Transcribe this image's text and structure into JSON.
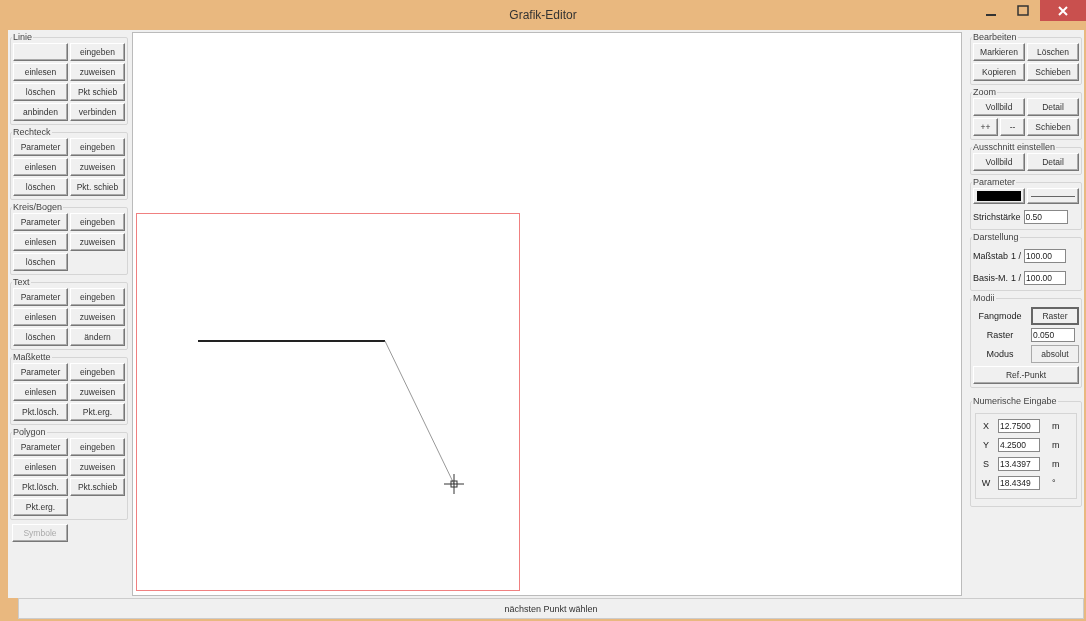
{
  "window": {
    "title": "Grafik-Editor"
  },
  "left_groups": [
    {
      "title": "Linie",
      "buttons": [
        {
          "kind": "blank"
        },
        {
          "label": "eingeben"
        },
        {
          "label": "einlesen"
        },
        {
          "label": "zuweisen"
        },
        {
          "label": "löschen"
        },
        {
          "label": "Pkt schieb"
        },
        {
          "label": "anbinden"
        },
        {
          "label": "verbinden"
        }
      ]
    },
    {
      "title": "Rechteck",
      "buttons": [
        {
          "label": "Parameter"
        },
        {
          "label": "eingeben"
        },
        {
          "label": "einlesen"
        },
        {
          "label": "zuweisen"
        },
        {
          "label": "löschen"
        },
        {
          "label": "Pkt. schieb"
        }
      ]
    },
    {
      "title": "Kreis/Bogen",
      "buttons": [
        {
          "label": "Parameter"
        },
        {
          "label": "eingeben"
        },
        {
          "label": "einlesen"
        },
        {
          "label": "zuweisen"
        },
        {
          "label": "löschen"
        }
      ]
    },
    {
      "title": "Text",
      "buttons": [
        {
          "label": "Parameter"
        },
        {
          "label": "eingeben"
        },
        {
          "label": "einlesen"
        },
        {
          "label": "zuweisen"
        },
        {
          "label": "löschen"
        },
        {
          "label": "ändern"
        }
      ]
    },
    {
      "title": "Maßkette",
      "buttons": [
        {
          "label": "Parameter"
        },
        {
          "label": "eingeben"
        },
        {
          "label": "einlesen"
        },
        {
          "label": "zuweisen"
        },
        {
          "label": "Pkt.lösch."
        },
        {
          "label": "Pkt.erg."
        }
      ]
    },
    {
      "title": "Polygon",
      "buttons": [
        {
          "label": "Parameter"
        },
        {
          "label": "eingeben"
        },
        {
          "label": "einlesen"
        },
        {
          "label": "zuweisen"
        },
        {
          "label": "Pkt.lösch."
        },
        {
          "label": "Pkt.schieb"
        },
        {
          "label": "Pkt.erg."
        }
      ]
    }
  ],
  "symbole_button": {
    "label": "Symbole",
    "disabled": true
  },
  "bearbeiten": {
    "title": "Bearbeiten",
    "buttons": [
      "Markieren",
      "Löschen",
      "Kopieren",
      "Schieben"
    ]
  },
  "zoom": {
    "title": "Zoom",
    "buttons": [
      "Vollbild",
      "Detail"
    ],
    "small_buttons": [
      "++",
      "--"
    ],
    "pan_button": "Schieben"
  },
  "ausschnitt": {
    "title": "Ausschnitt einstellen",
    "buttons": [
      "Vollbild",
      "Detail"
    ]
  },
  "parameter": {
    "title": "Parameter",
    "color": "#000000",
    "stroke_label": "Strichstärke",
    "stroke_value": "0.50"
  },
  "darstellung": {
    "title": "Darstellung",
    "rows": [
      {
        "label": "Maßstab",
        "prefix": "1 /",
        "value": "100.00"
      },
      {
        "label": "Basis-M.",
        "prefix": "1 /",
        "value": "100.00"
      }
    ]
  },
  "modii": {
    "title": "Modii",
    "fangmode_label": "Fangmode",
    "fangmode_button": "Raster",
    "raster_label": "Raster",
    "raster_value": "0.050",
    "modus_label": "Modus",
    "modus_button": "absolut",
    "ref_button": "Ref.-Punkt"
  },
  "numeric": {
    "title": "Numerische Eingabe",
    "rows": [
      {
        "label": "X",
        "value": "12.7500",
        "unit": "m"
      },
      {
        "label": "Y",
        "value": "4.2500",
        "unit": "m"
      },
      {
        "label": "S",
        "value": "13.4397",
        "unit": "m"
      },
      {
        "label": "W",
        "value": "18.4349",
        "unit": "°"
      }
    ]
  },
  "status_bar": "nächsten Punkt wählen"
}
